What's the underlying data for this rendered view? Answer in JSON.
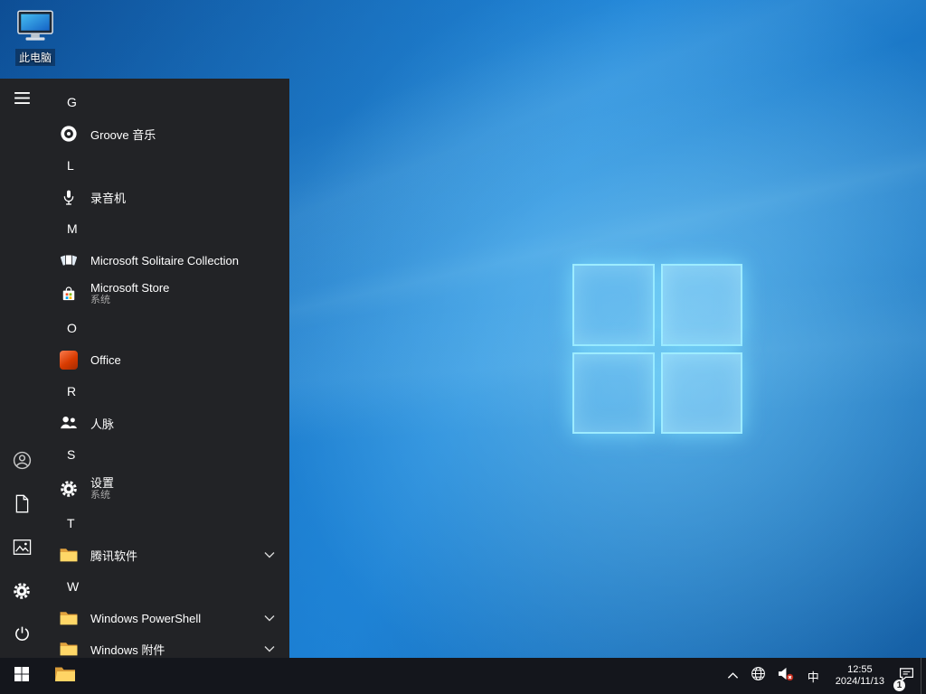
{
  "colors": {
    "wallpaper_blue": "#1478d0",
    "logo_cyan": "#a0eeff",
    "office_orange": "#d83b01",
    "folder_yellow": "#ffd767",
    "mute_red": "#c42b1c"
  },
  "desktop": {
    "this_pc_label": "此电脑"
  },
  "start_menu": {
    "rail_icons": [
      "hamburger-icon",
      "user-icon",
      "documents-icon",
      "pictures-icon",
      "settings-icon",
      "power-icon"
    ],
    "sections": [
      {
        "letter": "G",
        "apps": [
          {
            "name": "Groove 音乐",
            "icon": "groove-icon"
          }
        ]
      },
      {
        "letter": "L",
        "apps": [
          {
            "name": "录音机",
            "icon": "microphone-icon"
          }
        ]
      },
      {
        "letter": "M",
        "apps": [
          {
            "name": "Microsoft Solitaire Collection",
            "icon": "cards-icon"
          },
          {
            "name": "Microsoft Store",
            "subtitle": "系统",
            "icon": "store-icon"
          }
        ]
      },
      {
        "letter": "O",
        "apps": [
          {
            "name": "Office",
            "icon": "office-icon"
          }
        ]
      },
      {
        "letter": "R",
        "apps": [
          {
            "name": "人脉",
            "icon": "people-icon"
          }
        ]
      },
      {
        "letter": "S",
        "apps": [
          {
            "name": "设置",
            "subtitle": "系统",
            "icon": "gear-icon"
          }
        ]
      },
      {
        "letter": "T",
        "apps": [
          {
            "name": "腾讯软件",
            "icon": "folder-icon",
            "expandable": true
          }
        ]
      },
      {
        "letter": "W",
        "apps": [
          {
            "name": "Windows PowerShell",
            "icon": "folder-icon",
            "expandable": true
          },
          {
            "name": "Windows 附件",
            "icon": "folder-icon",
            "expandable": true
          }
        ]
      }
    ]
  },
  "taskbar": {
    "ime_indicator": "中",
    "clock": {
      "time": "12:55",
      "date": "2024/11/13"
    },
    "notification_badge": "1"
  }
}
